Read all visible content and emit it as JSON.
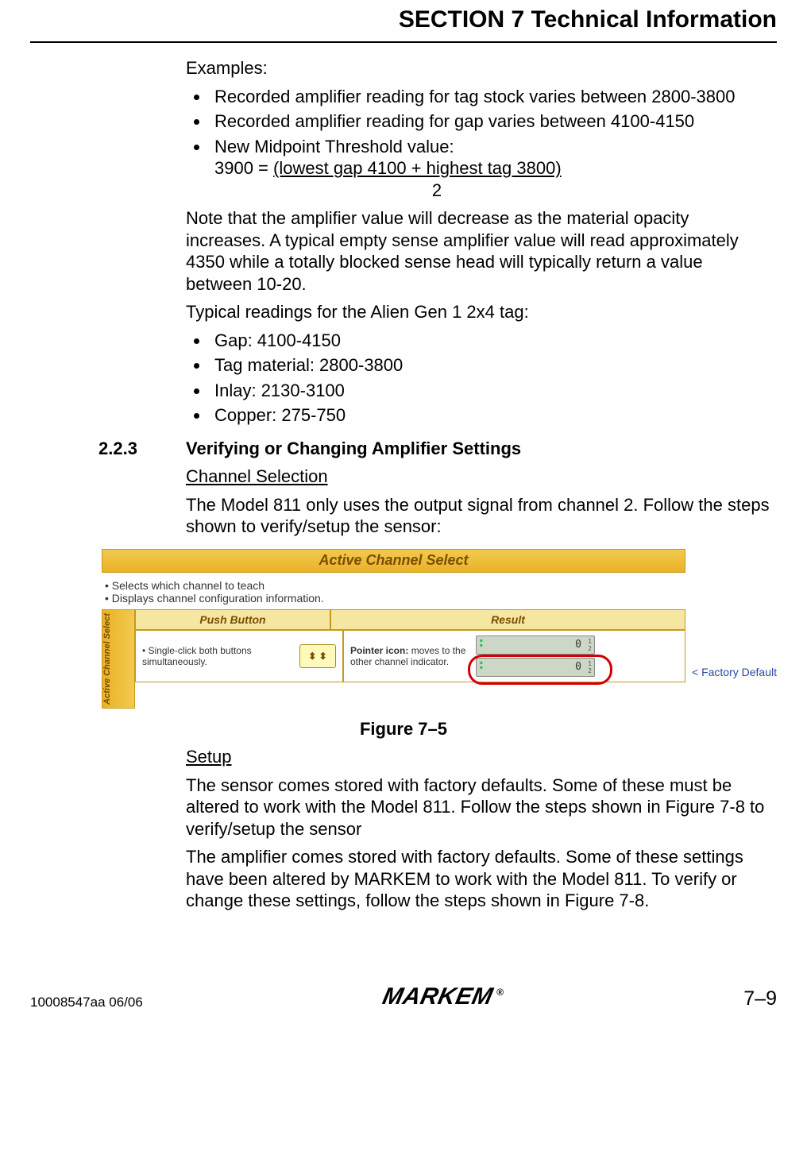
{
  "header": {
    "title": "SECTION 7 Technical Information"
  },
  "examples_label": "Examples:",
  "bullets1": [
    "Recorded amplifier reading for tag stock varies between 2800-3800",
    "Recorded amplifier reading for gap varies between 4100-4150"
  ],
  "midpoint": {
    "label": " New Midpoint Threshold value:",
    "equation_lhs": "3900 = ",
    "equation_top": "(lowest gap 4100 + highest tag 3800)",
    "equation_bot": "2"
  },
  "note_paragraph": "Note that the amplifier value will decrease as the material opacity increases. A typical empty sense amplifier value will read approximately 4350 while a totally blocked sense head will typically return a value between 10-20.",
  "typical_label": "Typical readings for the Alien Gen 1 2x4 tag:",
  "bullets2": [
    "Gap: 4100-4150",
    "Tag material: 2800-3800",
    "Inlay: 2130-3100",
    "Copper: 275-750"
  ],
  "section": {
    "number": "2.2.3",
    "title": "Verifying or Changing Amplifier Settings"
  },
  "channel_heading": "Channel Selection",
  "channel_para": "The Model 811 only uses the output signal from channel 2. Follow the steps shown to verify/setup the sensor:",
  "figure": {
    "titlebar": "Active Channel Select",
    "sub1": "Selects which channel to teach",
    "sub2": "Displays channel configuration information.",
    "sidelabel": "Active Channel Select",
    "head1": "Push Button",
    "head2": "Result",
    "cell1_text": "Single-click both buttons simultaneously.",
    "cell2_text": "Pointer icon: moves to the other channel indicator.",
    "lcd_value": "0",
    "factory": "< Factory Default",
    "caption": "Figure 7–5"
  },
  "setup_heading": "Setup",
  "setup_p1": "The sensor comes stored with factory defaults. Some of these must be altered to work with the Model 811.  Follow the steps shown in Figure 7-8 to verify/setup the sensor",
  "setup_p2": "The amplifier comes stored with factory defaults. Some of these settings have been altered by MARKEM to work with the Model 811. To verify or change these settings, follow the steps shown in Figure 7-8.",
  "footer": {
    "left": "10008547aa 06/06",
    "center": "MARKEM",
    "reg": "®",
    "right": "7–9"
  }
}
